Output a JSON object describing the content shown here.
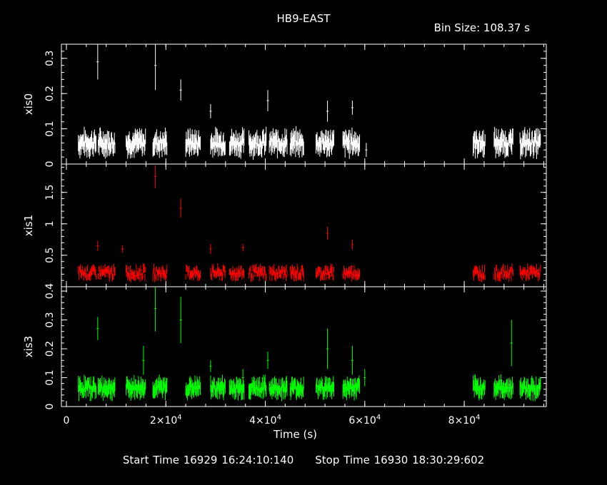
{
  "header": {
    "title": "HB9-EAST",
    "bin_size": "Bin Size: 108.37 s"
  },
  "footer": {
    "start_time": "Start Time 16929 16:24:10:140",
    "stop_time": "Stop Time 16930 18:30:29:602"
  },
  "chart_data": {
    "type": "scatter",
    "style": "errorbar-lightcurve",
    "xlabel": "Time (s)",
    "xlim": [
      -1000,
      96500
    ],
    "x_ticks": [
      {
        "value": 0,
        "mantissa": "0",
        "exponent": ""
      },
      {
        "value": 20000,
        "mantissa": "2×10",
        "exponent": "4"
      },
      {
        "value": 40000,
        "mantissa": "4×10",
        "exponent": "4"
      },
      {
        "value": 60000,
        "mantissa": "6×10",
        "exponent": "4"
      },
      {
        "value": 80000,
        "mantissa": "8×10",
        "exponent": "4"
      }
    ],
    "panels": [
      {
        "name": "xis0",
        "ylabel": "xis0",
        "color": "#ffffff",
        "ylim": [
          0,
          0.34
        ],
        "yticks": [
          {
            "v": 0,
            "l": "0"
          },
          {
            "v": 0.1,
            "l": "0.1"
          },
          {
            "v": 0.2,
            "l": "0.2"
          },
          {
            "v": 0.3,
            "l": "0.3"
          }
        ],
        "baseline": 0.06,
        "noise": 0.02,
        "errbar": 0.022,
        "spikes": [
          [
            6300,
            0.29,
            0.05
          ],
          [
            17900,
            0.28,
            0.07
          ],
          [
            23000,
            0.21,
            0.03
          ],
          [
            29000,
            0.15,
            0.02
          ],
          [
            40500,
            0.18,
            0.03
          ],
          [
            52500,
            0.15,
            0.03
          ],
          [
            57500,
            0.16,
            0.02
          ],
          [
            60300,
            0.04,
            0.02
          ]
        ]
      },
      {
        "name": "xis1",
        "ylabel": "xis1",
        "color": "#ff0000",
        "ylim": [
          0,
          1.95
        ],
        "yticks": [
          {
            "v": 0.5,
            "l": "0.5"
          },
          {
            "v": 1,
            "l": "1"
          },
          {
            "v": 1.5,
            "l": "1.5"
          }
        ],
        "baseline": 0.22,
        "noise": 0.08,
        "errbar": 0.06,
        "spikes": [
          [
            6300,
            0.65,
            0.08
          ],
          [
            11300,
            0.6,
            0.06
          ],
          [
            17900,
            1.75,
            0.18
          ],
          [
            23000,
            1.25,
            0.15
          ],
          [
            29000,
            0.6,
            0.08
          ],
          [
            35500,
            0.62,
            0.06
          ],
          [
            52500,
            0.85,
            0.1
          ],
          [
            57500,
            0.67,
            0.08
          ]
        ]
      },
      {
        "name": "xis3",
        "ylabel": "xis3",
        "color": "#00ff00",
        "ylim": [
          0,
          0.415
        ],
        "yticks": [
          {
            "v": 0,
            "l": "0"
          },
          {
            "v": 0.1,
            "l": "0.1"
          },
          {
            "v": 0.2,
            "l": "0.2"
          },
          {
            "v": 0.3,
            "l": "0.3"
          },
          {
            "v": 0.4,
            "l": "0.4"
          }
        ],
        "baseline": 0.065,
        "noise": 0.02,
        "errbar": 0.022,
        "spikes": [
          [
            6300,
            0.27,
            0.04
          ],
          [
            15500,
            0.16,
            0.05
          ],
          [
            17900,
            0.34,
            0.08
          ],
          [
            23000,
            0.3,
            0.08
          ],
          [
            29000,
            0.14,
            0.02
          ],
          [
            35500,
            0.1,
            0.03
          ],
          [
            40500,
            0.16,
            0.03
          ],
          [
            52500,
            0.2,
            0.07
          ],
          [
            57500,
            0.16,
            0.05
          ],
          [
            60000,
            0.1,
            0.03
          ],
          [
            89500,
            0.22,
            0.08
          ]
        ]
      }
    ],
    "segments": [
      [
        2400,
        6000
      ],
      [
        6400,
        9800
      ],
      [
        12000,
        16000
      ],
      [
        17400,
        20300
      ],
      [
        24000,
        27000
      ],
      [
        29000,
        32000
      ],
      [
        32800,
        35800
      ],
      [
        36700,
        40200
      ],
      [
        40800,
        44400
      ],
      [
        45000,
        47800
      ],
      [
        50200,
        53800
      ],
      [
        55600,
        59000
      ],
      [
        81800,
        84200
      ],
      [
        86000,
        89800
      ],
      [
        91200,
        95400
      ]
    ]
  }
}
